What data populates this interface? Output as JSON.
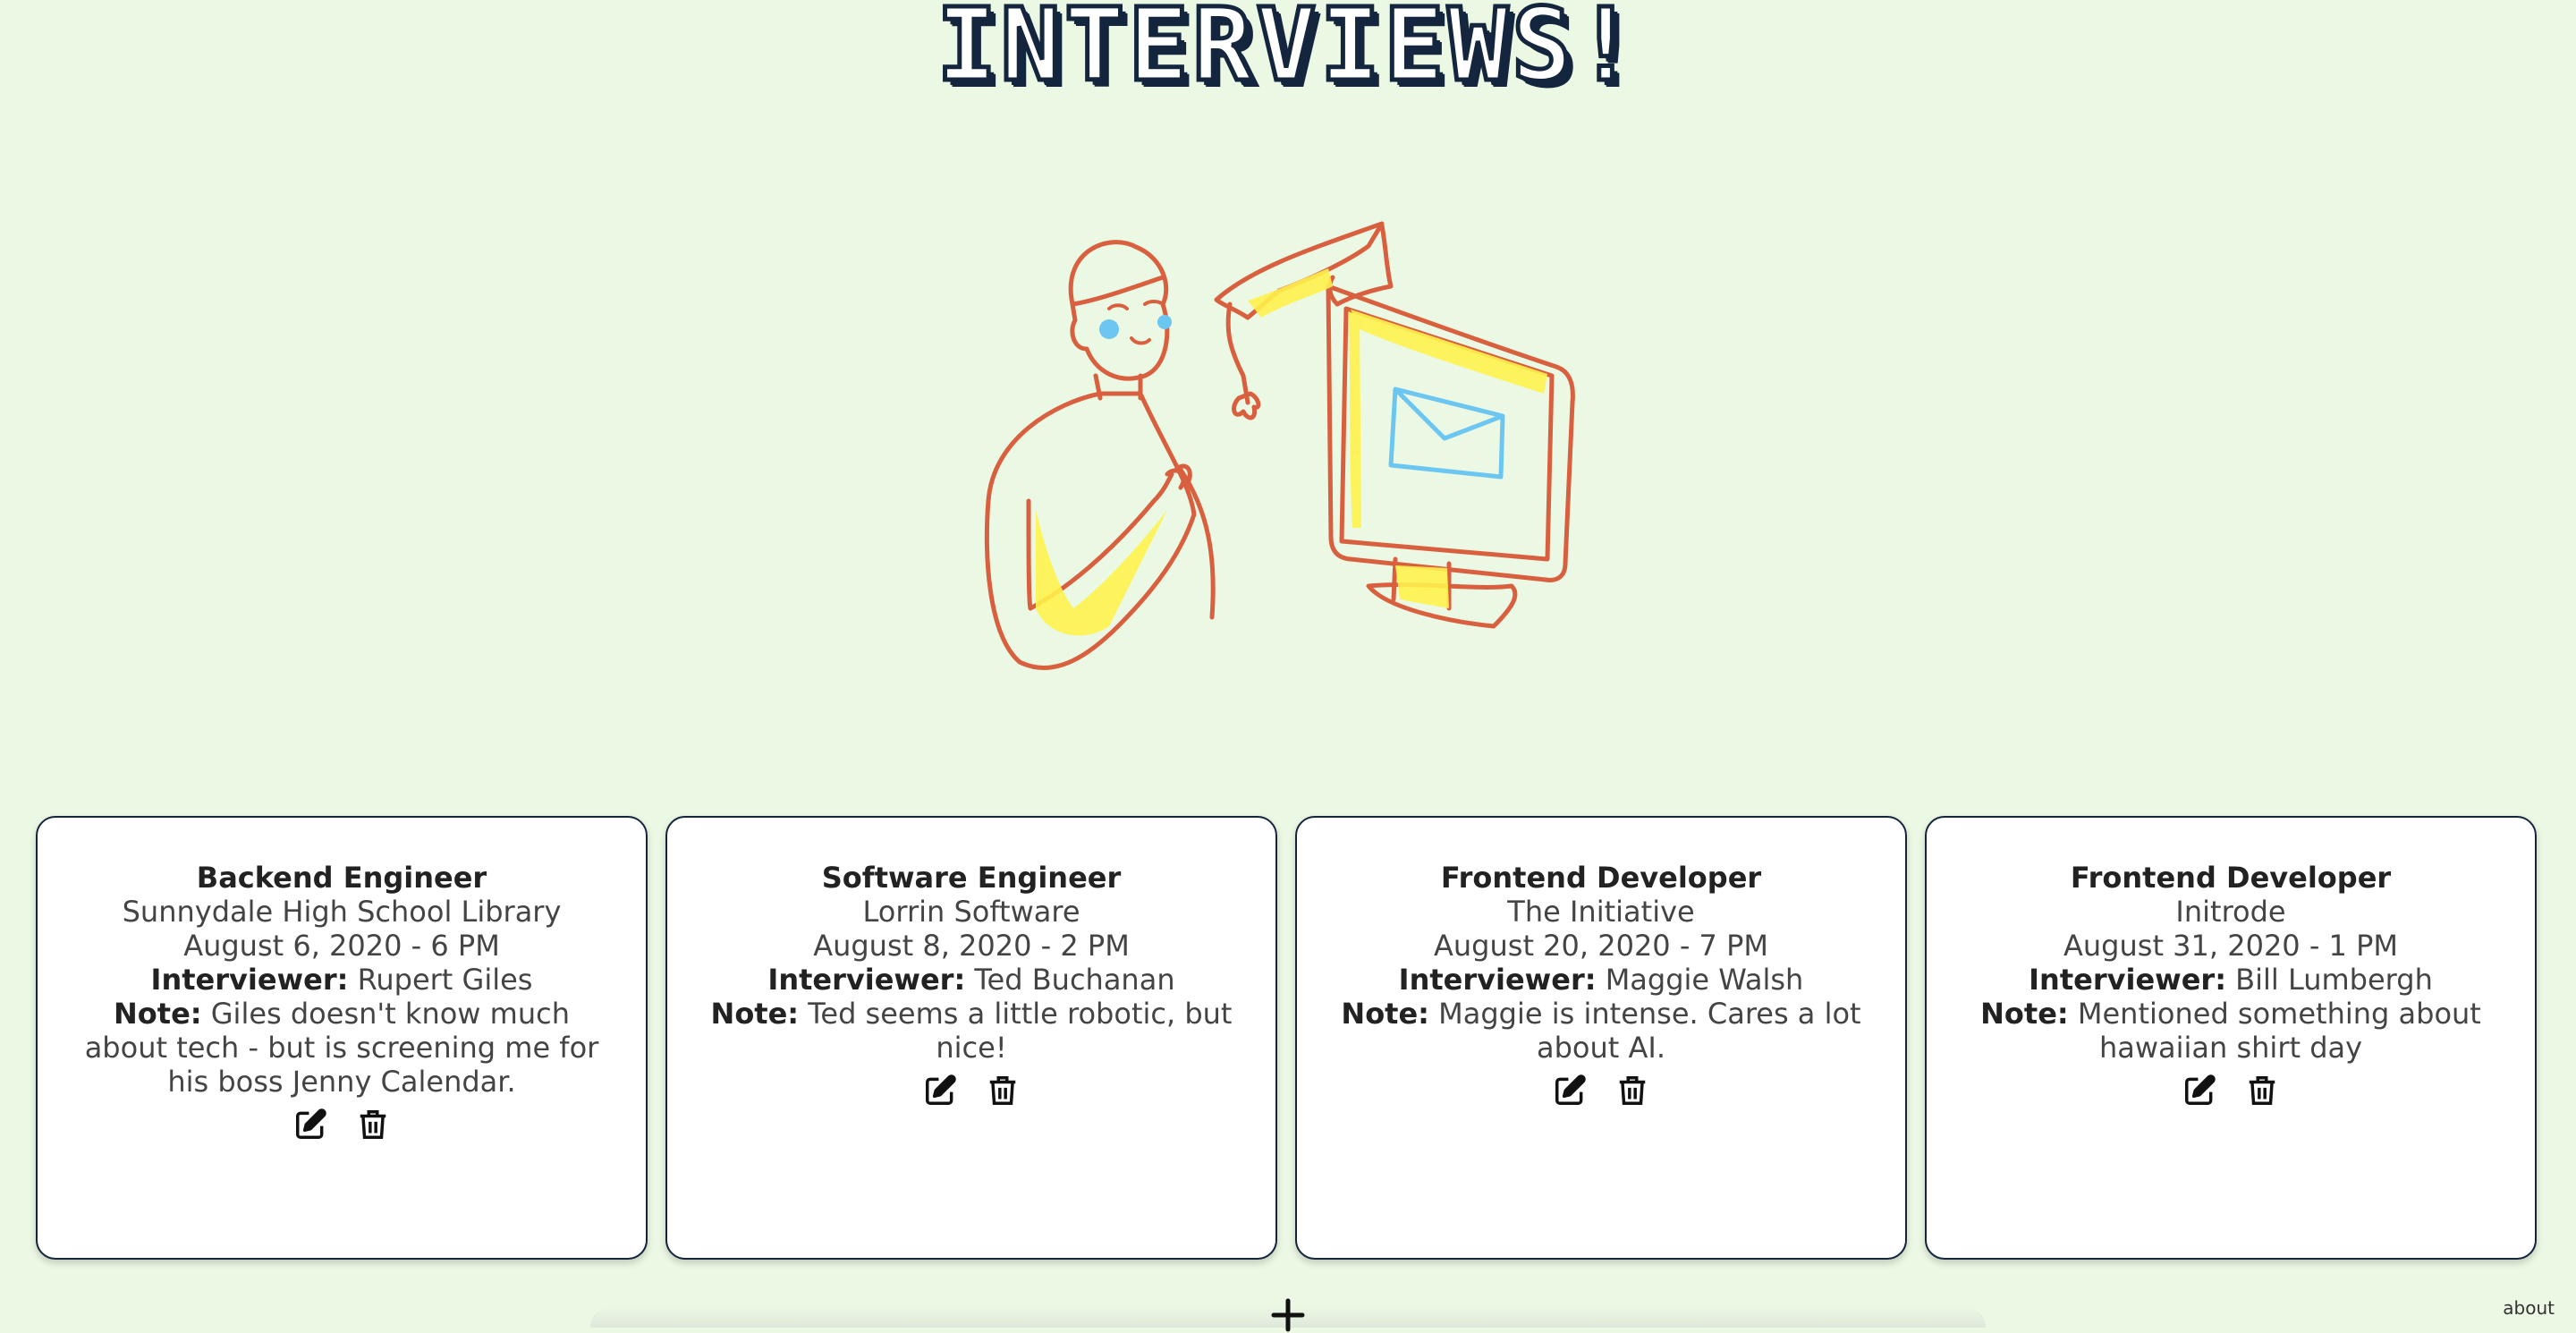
{
  "header": {
    "title": "INTERVIEWS!"
  },
  "cards": [
    {
      "role": "Backend Engineer",
      "company": "Sunnydale High School Library",
      "datetime": "August 6, 2020 - 6 PM",
      "interviewer_label": "Interviewer:",
      "interviewer": "Rupert Giles",
      "note_label": "Note:",
      "note": "Giles doesn't know much about tech - but is screening me for his boss Jenny Calendar."
    },
    {
      "role": "Software Engineer",
      "company": "Lorrin Software",
      "datetime": "August 8, 2020 - 2 PM",
      "interviewer_label": "Interviewer:",
      "interviewer": "Ted Buchanan",
      "note_label": "Note:",
      "note": "Ted seems a little robotic, but nice!"
    },
    {
      "role": "Frontend Developer",
      "company": "The Initiative",
      "datetime": "August 20, 2020 - 7 PM",
      "interviewer_label": "Interviewer:",
      "interviewer": "Maggie Walsh",
      "note_label": "Note:",
      "note": "Maggie is intense. Cares a lot about AI."
    },
    {
      "role": "Frontend Developer",
      "company": "Initrode",
      "datetime": "August 31, 2020 - 1 PM",
      "interviewer_label": "Interviewer:",
      "interviewer": "Bill Lumbergh",
      "note_label": "Note:",
      "note": "Mentioned something about hawaiian shirt day"
    }
  ],
  "footer": {
    "about_label": "about",
    "add_symbol": "+"
  },
  "colors": {
    "background": "#ebf8e4",
    "navy": "#14253e",
    "illustration_line": "#d9603f",
    "illustration_fill": "#fff24d",
    "envelope": "#6cc6f2"
  }
}
